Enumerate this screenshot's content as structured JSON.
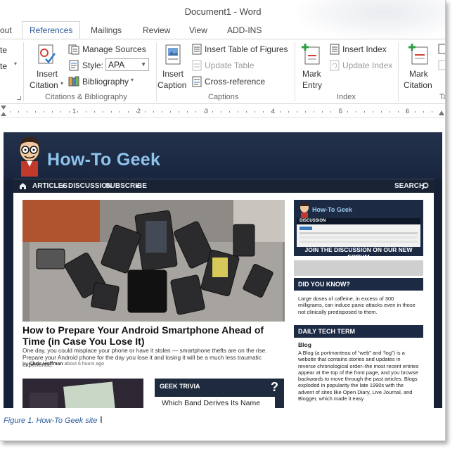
{
  "window": {
    "title": "Document1 - Word"
  },
  "tabs": [
    {
      "label": "out"
    },
    {
      "label": "References",
      "active": true
    },
    {
      "label": "Mailings"
    },
    {
      "label": "Review"
    },
    {
      "label": "View"
    },
    {
      "label": "ADD-INS"
    }
  ],
  "ribbon": {
    "cut_left_1": "te",
    "cut_left_2": "te",
    "insert_citation": "Insert Citation",
    "insert_citation_line1": "Insert",
    "insert_citation_line2": "Citation",
    "manage_sources": "Manage Sources",
    "style_label": "Style:",
    "style_value": "APA",
    "bibliography": "Bibliography",
    "group_citations": "Citations & Bibliography",
    "insert_caption_line1": "Insert",
    "insert_caption_line2": "Caption",
    "insert_table_of_figures": "Insert Table of Figures",
    "update_table": "Update Table",
    "cross_reference": "Cross-reference",
    "group_captions": "Captions",
    "mark_entry_line1": "Mark",
    "mark_entry_line2": "Entry",
    "insert_index": "Insert Index",
    "update_index": "Update Index",
    "group_index": "Index",
    "mark_citation_line1": "Mark",
    "mark_citation_line2": "Citation",
    "group_cut": "Ta"
  },
  "ruler": {
    "numbers": [
      "1",
      "2",
      "3",
      "4",
      "5",
      "6"
    ]
  },
  "website": {
    "logo_text": "How-To Geek",
    "nav": [
      "ARTICLES",
      "DISCUSSION",
      "SUBSCRIBE"
    ],
    "search": "SEARCH",
    "article_title": "How to Prepare Your Android Smartphone Ahead of Time (in Case You Lose It)",
    "article_desc": "One day, you could misplace your phone or have it stolen — smartphone thefts are on the rise. Prepare your Android phone for the day you lose it and losing it will be a much less traumatic experience.",
    "article_by": "by",
    "article_author": "Chris Hoffman",
    "article_time": "about 6 hours ago",
    "trivia_head": "GEEK TRIVIA",
    "trivia_question": "Which Band Derives Its Name",
    "trivia_icon": "?",
    "forum_logo": "How-To Geek",
    "forum_discussion": "DISCUSSION",
    "forum_join": "JOIN THE DISCUSSION ON OUR NEW FORUM",
    "did_you_know_head": "DID YOU KNOW?",
    "did_you_know_text": "Large doses of caffeine, in excess of 300 milligrams, can induce panic attacks even in those not clinically predisposed to them.",
    "daily_tech_head": "DAILY TECH TERM",
    "daily_tech_term": "Blog",
    "daily_tech_text": "A Blog (a portmanteau of “web” and “log”) is a website that contains stories and updates in reverse chronological order–the most recent entries appear at the top of the front page, and you browse backwards to move through the past articles. Blogs exploded in popularity the late 1990s with the advent of sites like Open Diary, Live Journal, and Blogger, which made it easy"
  },
  "caption": "Figure 1. How-To Geek site",
  "colors": {
    "accent": "#2b579a",
    "site_dark": "#1c2a44",
    "caption": "#2e5e9e"
  }
}
